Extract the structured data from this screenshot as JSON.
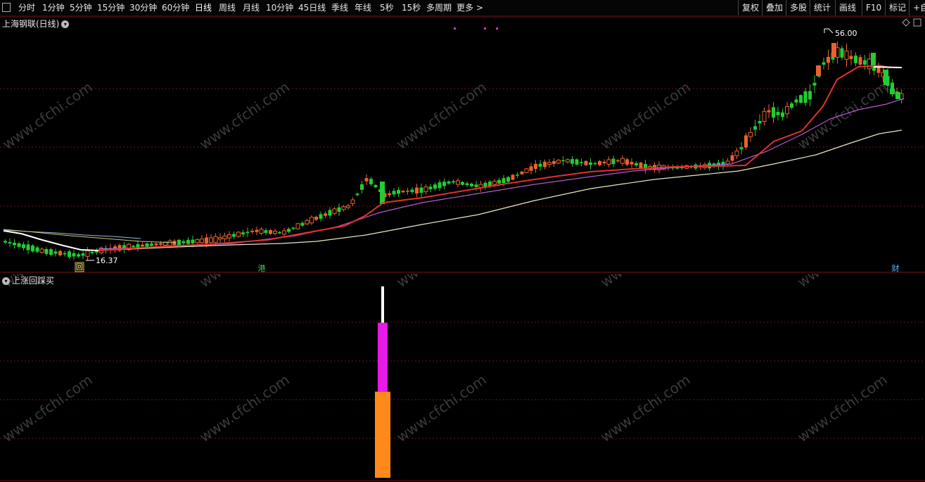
{
  "toolbar": {
    "periods": [
      "分时",
      "1分钟",
      "5分钟",
      "15分钟",
      "30分钟",
      "60分钟",
      "日线",
      "周线",
      "月线",
      "10分钟",
      "45日线",
      "季线",
      "年线",
      "5秒",
      "15秒",
      "多周期",
      "更多 >"
    ],
    "active": "日线",
    "right_buttons": [
      "复权",
      "叠加",
      "多股",
      "统计",
      "画线",
      "F10",
      "标记",
      "+自"
    ]
  },
  "main_panel": {
    "title": "上海钢联(日线)",
    "title_icon": "chevron-down-icon",
    "high_label": "56.00",
    "low_label": "16.37",
    "event_markers": [
      "回",
      "港",
      "财"
    ],
    "colors": {
      "up": "#e8622e",
      "down": "#22cc33",
      "ma_red": "#e23030",
      "ma_purple": "#b65ad6",
      "ma_white": "#e8e8c8",
      "grid": "#6a1a1a"
    }
  },
  "indicator_panel": {
    "title": "上涨回踩买",
    "title_icon": "chevron-down-icon",
    "segments": [
      {
        "color": "#ff8a1a",
        "from": 0,
        "to": 0.45
      },
      {
        "color": "#e61be6",
        "from": 0.45,
        "to": 0.81
      },
      {
        "color": "#ffffff",
        "from": 0.81,
        "to": 1.0
      }
    ]
  },
  "watermark": "www.cfchi.com"
}
